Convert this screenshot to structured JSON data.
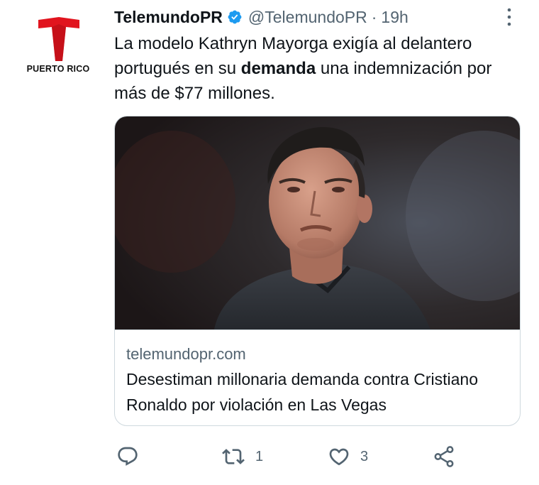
{
  "account": {
    "display_name": "TelemundoPR",
    "handle": "@TelemundoPR",
    "separator": "·",
    "time": "19h",
    "logo_text": "PUERTO RICO",
    "verified": true
  },
  "tweet": {
    "text_part1": "La modelo Kathryn Mayorga exigía al delantero portugués en su ",
    "text_bold": "demanda",
    "text_part2": " una indemnización por más de $77 millones."
  },
  "card": {
    "domain": "telemundopr.com",
    "title": "Desestiman millonaria demanda contra Cristiano Ronaldo por violación en Las Vegas",
    "image_icon": "player-photo"
  },
  "actions": {
    "reply_count": "",
    "retweet_count": "1",
    "like_count": "3"
  },
  "colors": {
    "brand_red": "#e1141e",
    "verified_blue": "#1d9bf0",
    "secondary_text": "#536471",
    "border": "#cfd9de"
  },
  "icons": [
    "verified-badge-icon",
    "more-icon",
    "reply-icon",
    "retweet-icon",
    "like-icon",
    "share-icon"
  ]
}
